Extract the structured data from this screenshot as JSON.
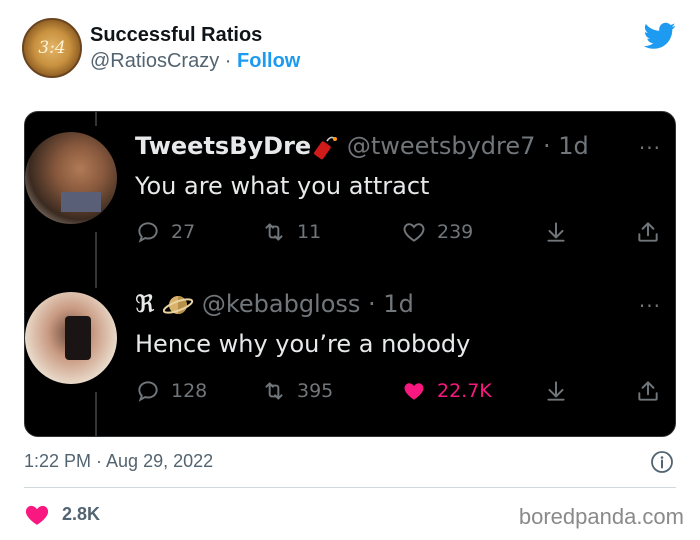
{
  "embed": {
    "display_name": "Successful Ratios",
    "handle": "@RatiosCrazy",
    "separator": "·",
    "follow_label": "Follow",
    "avatar_text": "3:4",
    "timestamp": "1:22 PM · Aug 29, 2022",
    "like_count": "2.8K"
  },
  "screenshot": {
    "tweets": [
      {
        "display_name": "TweetsByDre",
        "emoji": "firecracker",
        "meta": "@tweetsbydre7 · 1d",
        "text": "You are what you attract",
        "replies": "27",
        "retweets": "11",
        "likes": "239",
        "liked": false
      },
      {
        "display_name": "ℜ",
        "emoji": "ringed-planet",
        "meta": "@kebabgloss · 1d",
        "text": "Hence why you’re a nobody",
        "replies": "128",
        "retweets": "395",
        "likes": "22.7K",
        "liked": true
      }
    ],
    "more_label": "···"
  },
  "watermark": "boredpanda.com",
  "colors": {
    "twitter_blue": "#1d9bf0",
    "like_pink": "#f91880",
    "dark_bg": "#000000",
    "muted_text": "#71767b"
  }
}
